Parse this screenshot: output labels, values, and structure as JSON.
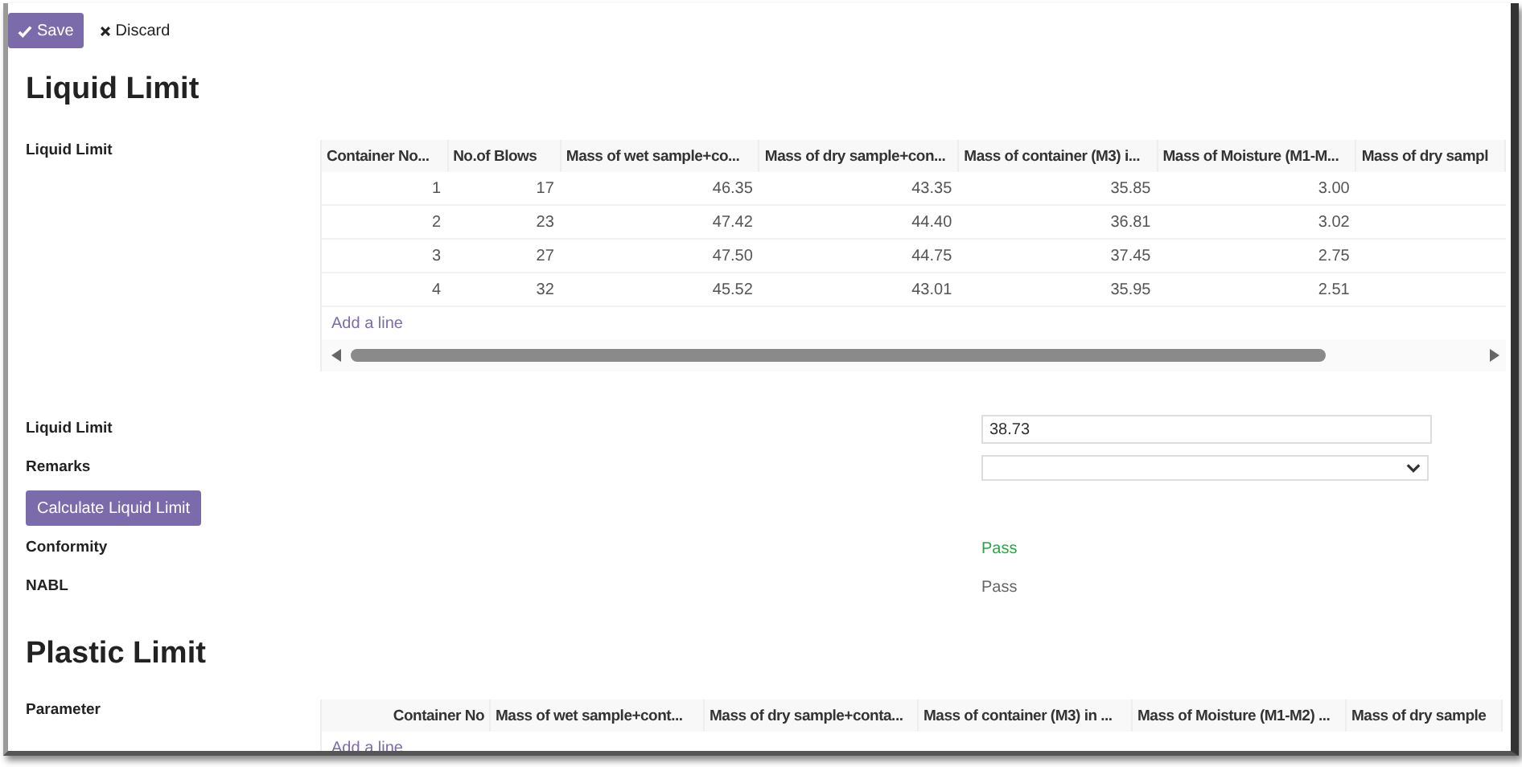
{
  "toolbar": {
    "save": "Save",
    "discard": "Discard"
  },
  "liquid_limit": {
    "title": "Liquid Limit",
    "table_label": "Liquid Limit",
    "columns": [
      "Container No...",
      "No.of Blows",
      "Mass of wet sample+co...",
      "Mass of dry sample+con...",
      "Mass of container (M3) i...",
      "Mass of Moisture (M1-M...",
      "Mass of dry sampl"
    ],
    "rows": [
      [
        "1",
        "17",
        "46.35",
        "43.35",
        "35.85",
        "3.00"
      ],
      [
        "2",
        "23",
        "47.42",
        "44.40",
        "36.81",
        "3.02"
      ],
      [
        "3",
        "27",
        "47.50",
        "44.75",
        "37.45",
        "2.75"
      ],
      [
        "4",
        "32",
        "45.52",
        "43.01",
        "35.95",
        "2.51"
      ]
    ],
    "add_line": "Add a line",
    "form": [
      {
        "kind": "input",
        "label": "Liquid Limit",
        "value": "38.73"
      },
      {
        "kind": "select",
        "label": "Remarks"
      },
      {
        "kind": "button",
        "label": "Calculate Liquid Limit"
      },
      {
        "kind": "text",
        "label": "Conformity",
        "value": "Pass",
        "color": "#28a745"
      },
      {
        "kind": "text",
        "label": "NABL",
        "value": "Pass",
        "color": "#666666"
      }
    ]
  },
  "plastic_limit": {
    "title": "Plastic Limit",
    "table_label": "Parameter",
    "columns": [
      "Container No",
      "Mass of wet sample+cont...",
      "Mass of dry sample+conta...",
      "Mass of container (M3) in ...",
      "Mass of Moisture (M1-M2) ...",
      "Mass of dry sample"
    ],
    "add_line": "Add a line"
  }
}
